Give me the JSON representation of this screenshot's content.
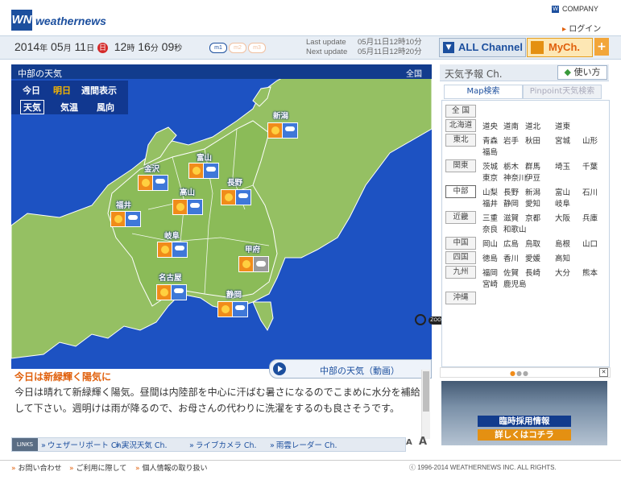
{
  "header": {
    "logo_mark": "WN",
    "logo_text": "weathernews",
    "company": "COMPANY",
    "login": "ログイン"
  },
  "datebar": {
    "year": "2014",
    "year_unit": "年",
    "month": "05",
    "month_unit": "月",
    "day": "11",
    "day_unit": "日",
    "weekday": "日",
    "hour": "12",
    "hour_unit": "時",
    "minute": "16",
    "minute_unit": "分",
    "second": "09",
    "second_unit": "秒",
    "pills": [
      "m1",
      "m2",
      "m3"
    ],
    "last_update_label": "Last update",
    "last_update_value": "05月11日12時10分",
    "next_update_label": "Next update",
    "next_update_value": "05月11日12時20分",
    "all_channel": "ALL Channel",
    "mych": "MyCh.",
    "plus": "+"
  },
  "map": {
    "title": "中部の天気",
    "zoom_scope": "全国",
    "day_tabs": [
      "今日",
      "明日",
      "週間表示"
    ],
    "active_day": "明日",
    "type_tabs": [
      "天気",
      "気温",
      "風向"
    ],
    "active_type": "天気",
    "cities": [
      "新潟",
      "富山",
      "金沢",
      "長野",
      "高山",
      "福井",
      "岐阜",
      "甲府",
      "名古屋",
      "静岡"
    ],
    "zoom_out": "ZOOM OUT",
    "video_label": "中部の天気（動画）"
  },
  "forecast": {
    "headline": "今日は新緑輝く陽気に",
    "body": "今日は晴れて新緑輝く陽気。昼間は内陸部を中心に汗ばむ暑さになるのでこまめに水分を補給して下さい。週明けは雨が降るので、お母さんの代わりに洗濯をするのも良さそうです。"
  },
  "links": {
    "header": "LINKS",
    "items": [
      "ウェザーリポート Ch.",
      "実況天気 Ch.",
      "ライブカメラ Ch.",
      "雨雲レーダー Ch."
    ],
    "font_small": "A",
    "font_large": "A"
  },
  "right_panel": {
    "title": "天気予報 Ch.",
    "howto": "使い方",
    "tabs": [
      "Map検索",
      "Pinpoint天気検索"
    ],
    "active_tab": "Map検索",
    "regions": [
      {
        "name": "全 国",
        "prefs": []
      },
      {
        "name": "北海道",
        "prefs": [
          "道央",
          "道南",
          "道北",
          "道東"
        ]
      },
      {
        "name": "東北",
        "prefs": [
          "青森",
          "岩手",
          "秋田",
          "宮城",
          "山形",
          "福島"
        ]
      },
      {
        "name": "関東",
        "prefs": [
          "茨城",
          "栃木",
          "群馬",
          "埼玉",
          "千葉",
          "東京",
          "神奈川",
          "伊豆"
        ]
      },
      {
        "name": "中部",
        "prefs": [
          "山梨",
          "長野",
          "新潟",
          "富山",
          "石川",
          "福井",
          "静岡",
          "愛知",
          "岐阜"
        ]
      },
      {
        "name": "近畿",
        "prefs": [
          "三重",
          "滋賀",
          "京都",
          "大阪",
          "兵庫",
          "奈良",
          "和歌山"
        ]
      },
      {
        "name": "中国",
        "prefs": [
          "岡山",
          "広島",
          "鳥取",
          "島根",
          "山口"
        ]
      },
      {
        "name": "四国",
        "prefs": [
          "徳島",
          "香川",
          "愛媛",
          "高知"
        ]
      },
      {
        "name": "九州",
        "prefs": [
          "福岡",
          "佐賀",
          "長崎",
          "大分",
          "熊本",
          "宮崎",
          "鹿児島"
        ]
      },
      {
        "name": "沖縄",
        "prefs": []
      }
    ],
    "active_region": "中部",
    "ad_title": "臨時採用情報",
    "ad_cta": "詳しくはコチラ"
  },
  "footer": {
    "links": [
      "お問い合わせ",
      "ご利用に際して",
      "個人情報の取り扱い"
    ],
    "copyright": "ⓒ 1996-2014 WEATHERNEWS INC. ALL RIGHTS."
  },
  "colors": {
    "brand_blue": "#1c4f9e",
    "accent_orange": "#e0600c",
    "sea": "#1d52c2",
    "land": "#95c063"
  }
}
